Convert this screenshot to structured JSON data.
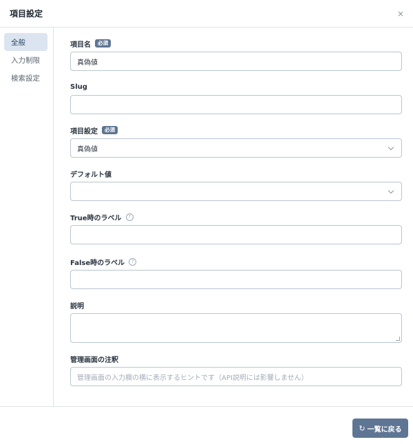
{
  "header": {
    "title": "項目設定",
    "close_glyph": "×"
  },
  "sidebar": {
    "items": [
      {
        "label": "全般",
        "active": true
      },
      {
        "label": "入力制限",
        "active": false
      },
      {
        "label": "検索設定",
        "active": false
      }
    ]
  },
  "form": {
    "field_name": {
      "label": "項目名",
      "badge": "必須",
      "value": "真偽値"
    },
    "slug": {
      "label": "Slug",
      "value": ""
    },
    "field_type": {
      "label": "項目設定",
      "badge": "必須",
      "value": "真偽値"
    },
    "default_value": {
      "label": "デフォルト値",
      "value": ""
    },
    "true_label": {
      "label": "True時のラベル",
      "help_glyph": "?",
      "value": ""
    },
    "false_label": {
      "label": "False時のラベル",
      "help_glyph": "?",
      "value": ""
    },
    "description": {
      "label": "説明",
      "value": ""
    },
    "admin_note": {
      "label": "管理画面の注釈",
      "placeholder": "管理画面の入力欄の横に表示するヒントです（API説明には影響しません）"
    }
  },
  "footer": {
    "back_label": "一覧に戻る",
    "back_glyph": "↻"
  },
  "colors": {
    "accent": "#5e7593",
    "sidebar_active_bg": "#dbe4ef",
    "border": "#b9c4d0"
  }
}
